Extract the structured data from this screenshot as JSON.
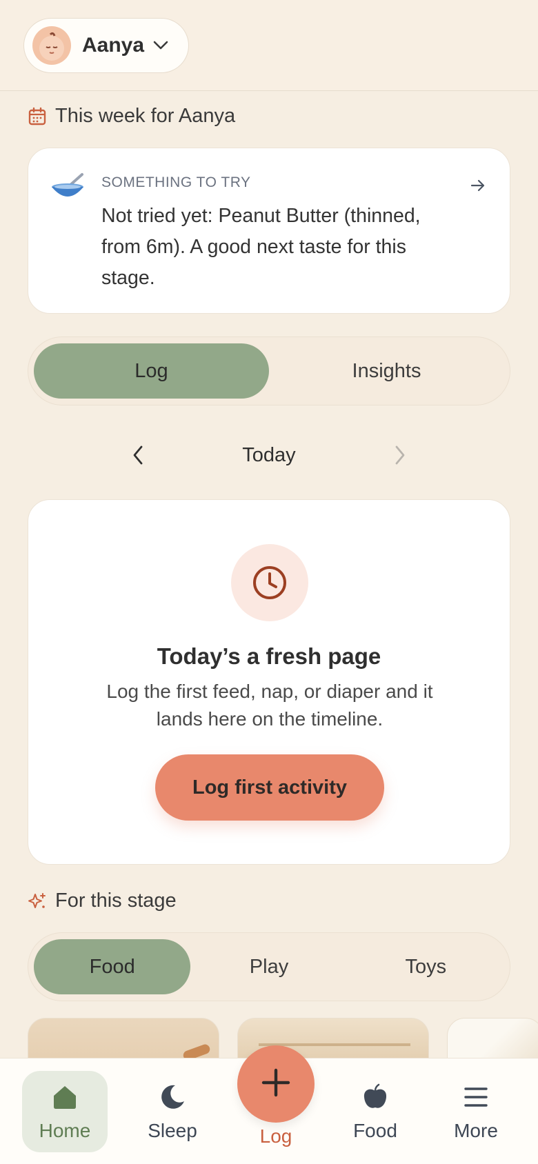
{
  "header": {
    "profile_name": "Aanya"
  },
  "week": {
    "title": "This week for Aanya"
  },
  "suggestion": {
    "eyebrow": "SOMETHING TO TRY",
    "text": "Not tried yet: Peanut Butter (thinned, from 6m). A good next taste for this stage."
  },
  "view_tabs": [
    {
      "label": "Log",
      "active": true
    },
    {
      "label": "Insights",
      "active": false
    }
  ],
  "day_nav": {
    "label": "Today"
  },
  "empty_state": {
    "title": "Today’s a fresh page",
    "description": "Log the first feed, nap, or diaper and it lands here on the timeline.",
    "cta": "Log first activity"
  },
  "stage": {
    "title": "For this stage",
    "tabs": [
      {
        "label": "Food",
        "active": true
      },
      {
        "label": "Play",
        "active": false
      },
      {
        "label": "Toys",
        "active": false
      }
    ]
  },
  "bottom_nav": {
    "items": [
      {
        "label": "Home",
        "icon": "home-icon",
        "active": true
      },
      {
        "label": "Sleep",
        "icon": "moon-icon",
        "active": false
      },
      {
        "label": "Log",
        "icon": "plus-icon",
        "active": false
      },
      {
        "label": "Food",
        "icon": "apple-icon",
        "active": false
      },
      {
        "label": "More",
        "icon": "menu-icon",
        "active": false
      }
    ]
  },
  "colors": {
    "background": "#f6eee2",
    "accent": "#e8886c",
    "active_tab": "#92a889",
    "nav_active_bg": "#e6ebe0"
  }
}
